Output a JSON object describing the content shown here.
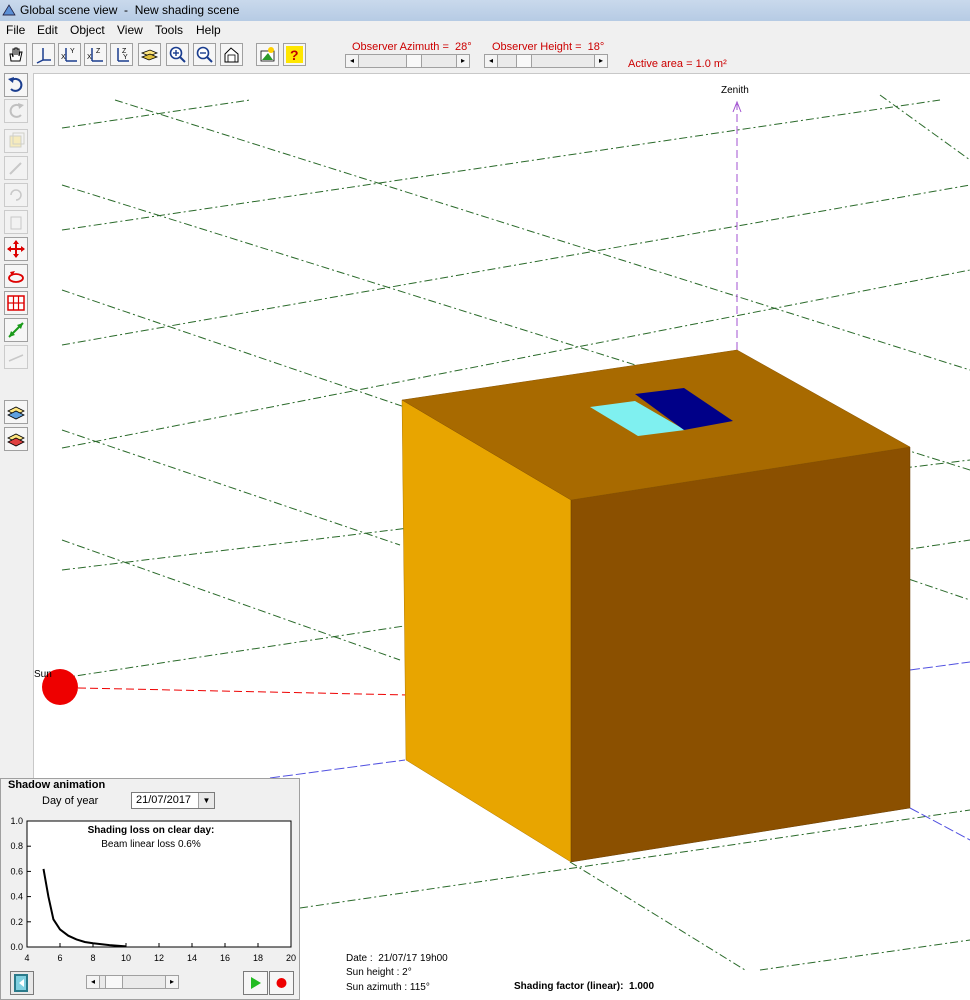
{
  "window": {
    "title": "Global scene view  -  New shading scene"
  },
  "menu": {
    "items": [
      "File",
      "Edit",
      "Object",
      "View",
      "Tools",
      "Help"
    ]
  },
  "toolbar": {
    "observer_azimuth_label": "Observer Azimuth =  28°",
    "observer_height_label": "Observer Height =  18°",
    "active_area": "Active area = 1.0 m²",
    "observer_azimuth_deg": 28,
    "observer_height_deg": 18
  },
  "scene": {
    "zenith_label": "Zenith",
    "sun_label": "Sun"
  },
  "animation": {
    "title": "Shadow animation",
    "day_label": "Day of year",
    "date_value": "21/07/2017",
    "chart_title": "Shading loss on clear day:",
    "chart_subtitle": "Beam linear loss 0.6%",
    "y_ticks": [
      "1.0",
      "0.8",
      "0.6",
      "0.4",
      "0.2",
      "0.0"
    ],
    "x_ticks": [
      "4",
      "6",
      "8",
      "10",
      "12",
      "14",
      "16",
      "18",
      "20"
    ],
    "curve": [
      [
        5.0,
        0.62
      ],
      [
        5.3,
        0.4
      ],
      [
        5.6,
        0.22
      ],
      [
        6.0,
        0.14
      ],
      [
        6.5,
        0.09
      ],
      [
        7.0,
        0.06
      ],
      [
        7.5,
        0.04
      ],
      [
        8.0,
        0.03
      ],
      [
        9.0,
        0.015
      ],
      [
        10.0,
        0.005
      ]
    ]
  },
  "status": {
    "date": "Date :  21/07/17 19h00",
    "sun_height": "Sun height : 2°",
    "sun_azimuth": "Sun azimuth : 115°",
    "shading_factor": "Shading factor (linear):  1.000"
  },
  "colors": {
    "box_left": "#e8a500",
    "box_front": "#8b5000",
    "box_top": "#a86a00",
    "panel_light": "#7ff0f0",
    "panel_dark": "#000088",
    "sun": "#ee0000",
    "grid": "#2a6a2a",
    "zenith": "#a050d0"
  }
}
